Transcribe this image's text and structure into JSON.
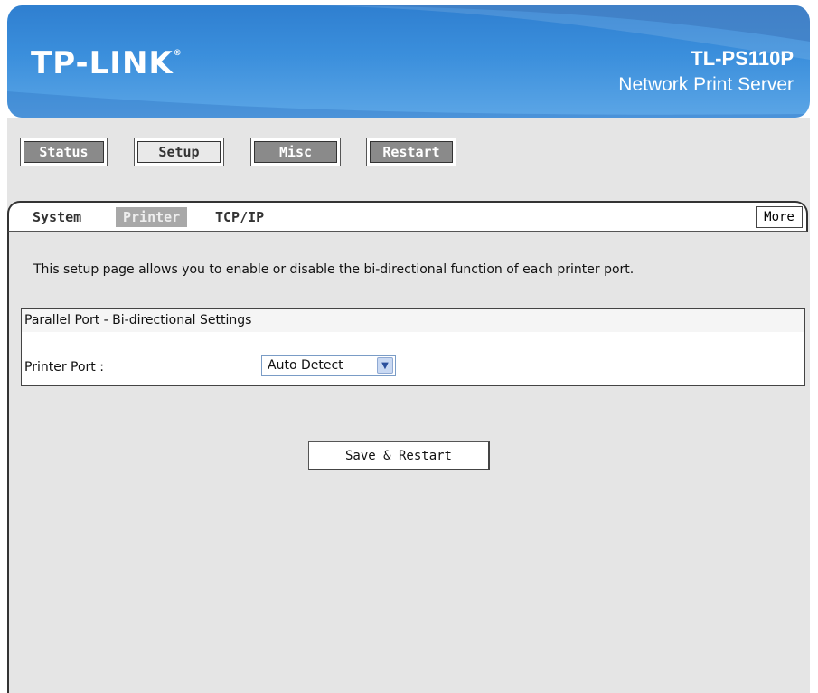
{
  "header": {
    "logo": "TP-LINK",
    "logo_mark": "®",
    "model": "TL-PS110P",
    "product": "Network Print Server"
  },
  "menu": {
    "items": [
      {
        "label": "Status",
        "style": "dark"
      },
      {
        "label": "Setup",
        "style": "light"
      },
      {
        "label": "Misc",
        "style": "dark"
      },
      {
        "label": "Restart",
        "style": "dark"
      }
    ]
  },
  "subtabs": {
    "items": [
      {
        "label": "System",
        "active": false
      },
      {
        "label": "Printer",
        "active": true
      },
      {
        "label": "TCP/IP",
        "active": false
      }
    ],
    "more_label": "More"
  },
  "page": {
    "description": "This setup page allows you to enable or disable the bi-directional function of each printer port.",
    "section_title": "Parallel Port - Bi-directional Settings",
    "port_label": "Printer Port :",
    "port_value": "Auto Detect",
    "save_label": "Save & Restart"
  },
  "colors": {
    "header_blue": "#3b8fdc",
    "panel_gray": "#e5e5e5",
    "button_dark": "#8a8a8a",
    "tab_active": "#a8a8a8"
  }
}
